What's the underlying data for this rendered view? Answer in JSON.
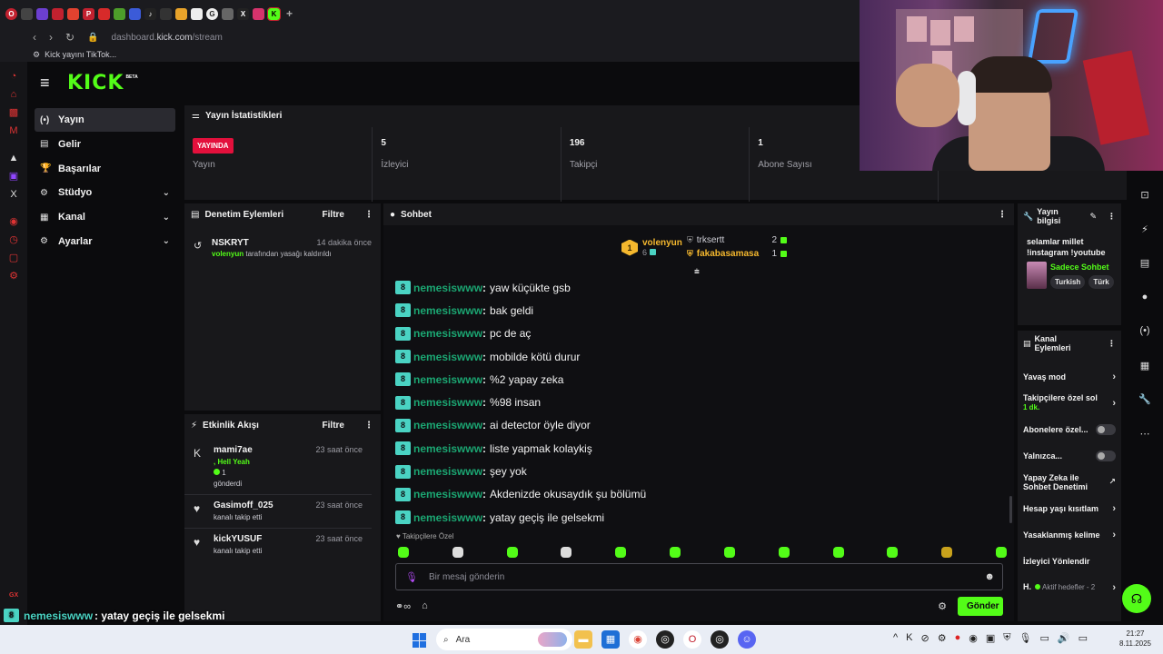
{
  "browser": {
    "url_prefix": "dashboard.",
    "url_host": "kick.com",
    "url_path": "/stream",
    "bookmark": "Kick yayını TikTok..."
  },
  "brand": {
    "logo": "KICK",
    "beta": "BETA"
  },
  "nav": [
    {
      "label": "Yayın",
      "icon": "broadcast-icon",
      "glyph": "(•)",
      "active": true,
      "expandable": false
    },
    {
      "label": "Gelir",
      "icon": "revenue-icon",
      "glyph": "▤",
      "active": false,
      "expandable": false
    },
    {
      "label": "Başarılar",
      "icon": "trophy-icon",
      "glyph": "🏆",
      "active": false,
      "expandable": false
    },
    {
      "label": "Stüdyo",
      "icon": "studio-icon",
      "glyph": "⚙",
      "active": false,
      "expandable": true
    },
    {
      "label": "Kanal",
      "icon": "channel-icon",
      "glyph": "▦",
      "active": false,
      "expandable": true
    },
    {
      "label": "Ayarlar",
      "icon": "settings-icon",
      "glyph": "⚙",
      "active": false,
      "expandable": true
    }
  ],
  "stats": {
    "title": "Yayın İstatistikleri",
    "live_badge": "YAYINDA",
    "items": [
      {
        "value": "",
        "label": "Yayın"
      },
      {
        "value": "5",
        "label": "İzleyici"
      },
      {
        "value": "196",
        "label": "Takipçi"
      },
      {
        "value": "1",
        "label": "Abone Sayısı"
      },
      {
        "value": "",
        "label": ""
      }
    ]
  },
  "moderation": {
    "title": "Denetim Eylemleri",
    "filter": "Filtre",
    "entries": [
      {
        "user": "NSKRYT",
        "time": "14 dakika önce",
        "actor": "volenyun",
        "action": " tarafından yasağı kaldırıldı"
      }
    ]
  },
  "activity": {
    "title": "Etkinlik Akışı",
    "filter": "Filtre",
    "events": [
      {
        "user": "mami7ae",
        "time": "23 saat önce",
        "icon": "kick-icon",
        "glyph": "K",
        "line1": ", Hell Yeah",
        "line2": "1",
        "line3": "gönderdi"
      },
      {
        "user": "Gasimoff_025",
        "time": "23 saat önce",
        "icon": "heart-icon",
        "glyph": "♥",
        "line1": "kanalı takip etti"
      },
      {
        "user": "kickYUSUF",
        "time": "23 saat önce",
        "icon": "heart-icon",
        "glyph": "♥",
        "line1": "kanalı takip etti"
      }
    ]
  },
  "chat": {
    "title": "Sohbet",
    "top_users": {
      "first": {
        "name": "volenyun",
        "count": "6",
        "rank": "1"
      },
      "second": {
        "name": "trksertt",
        "count": "2"
      },
      "third": {
        "name": "fakabasamasa",
        "count": "1"
      }
    },
    "messages": [
      {
        "user": "nemesiswww",
        "text": "yaw küçükte gsb"
      },
      {
        "user": "nemesiswww",
        "text": "bak geldi"
      },
      {
        "user": "nemesiswww",
        "text": "pc de aç"
      },
      {
        "user": "nemesiswww",
        "text": "mobilde kötü durur"
      },
      {
        "user": "nemesiswww",
        "text": "%2 yapay zeka"
      },
      {
        "user": "nemesiswww",
        "text": "%98 insan"
      },
      {
        "user": "nemesiswww",
        "text": "ai detector öyle diyor"
      },
      {
        "user": "nemesiswww",
        "text": "liste yapmak kolaykiş"
      },
      {
        "user": "nemesiswww",
        "text": "şey yok"
      },
      {
        "user": "nemesiswww",
        "text": "Akdenizde okusaydık şu bölümü"
      },
      {
        "user": "nemesiswww",
        "text": "yatay geçiş ile gelsekmi"
      }
    ],
    "followers_only_label": "Takipçilere Özel",
    "input_placeholder": "Bir mesaj gönderin",
    "send_label": "Gönder"
  },
  "stream_info": {
    "title_line1": "Yayın",
    "title_line2": "bilgisi",
    "description_line1": "selamlar millet",
    "description_line2": "!instagram !youtube",
    "category": "Sadece Sohbet",
    "tags": [
      "Turkish",
      "Türk"
    ]
  },
  "channel_actions": {
    "title_line1": "Kanal",
    "title_line2": "Eylemleri",
    "items": [
      {
        "label": "Yavaş mod",
        "control": "arrow"
      },
      {
        "label": "Takipçilere özel sol",
        "sub": "1 dk.",
        "control": "arrow"
      },
      {
        "label": "Abonelere özel...",
        "control": "toggle"
      },
      {
        "label": "Yalnızca...",
        "control": "toggle"
      },
      {
        "label": "Yapay Zeka ile Sohbet Denetimi",
        "control": "external"
      },
      {
        "label": "Hesap yaşı kısıtlam",
        "control": "arrow"
      },
      {
        "label": "Yasaklanmış kelime",
        "control": "arrow"
      },
      {
        "label": "İzleyici Yönlendir",
        "control": "none"
      },
      {
        "label": "H.",
        "sub_inline": "Aktif hedefler - 2",
        "control": "arrow"
      }
    ]
  },
  "overlay": {
    "user": "nemesiswww",
    "text": " : yatay geçiş ile gelsekmi",
    "gx": "GX"
  },
  "taskbar": {
    "search": "Ara",
    "time": "21:27",
    "date": "8.11.2025"
  }
}
